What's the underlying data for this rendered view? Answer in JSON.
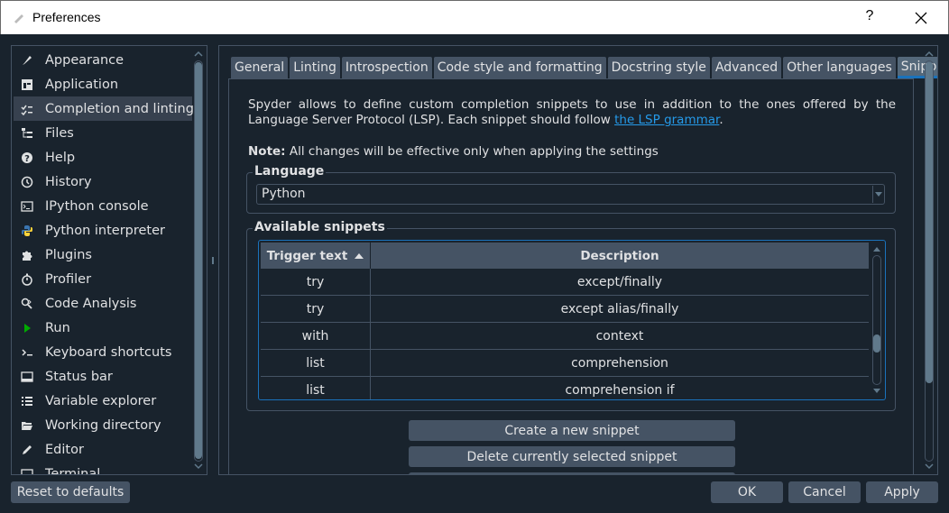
{
  "window": {
    "title": "Preferences",
    "help_label": "?"
  },
  "sidebar": {
    "items": [
      {
        "label": "Appearance",
        "icon": "paintbrush-icon"
      },
      {
        "label": "Application",
        "icon": "window-grid-icon"
      },
      {
        "label": "Completion and linting",
        "icon": "check-list-icon",
        "selected": true
      },
      {
        "label": "Files",
        "icon": "file-tree-icon"
      },
      {
        "label": "Help",
        "icon": "question-circle-icon"
      },
      {
        "label": "History",
        "icon": "history-icon"
      },
      {
        "label": "IPython console",
        "icon": "terminal-icon"
      },
      {
        "label": "Python interpreter",
        "icon": "python-logo-icon"
      },
      {
        "label": "Plugins",
        "icon": "puzzle-icon"
      },
      {
        "label": "Profiler",
        "icon": "stopwatch-icon"
      },
      {
        "label": "Code Analysis",
        "icon": "search-code-icon"
      },
      {
        "label": "Run",
        "icon": "play-icon"
      },
      {
        "label": "Keyboard shortcuts",
        "icon": "keyboard-icon"
      },
      {
        "label": "Status bar",
        "icon": "status-bar-icon"
      },
      {
        "label": "Variable explorer",
        "icon": "variable-list-icon"
      },
      {
        "label": "Working directory",
        "icon": "folder-open-icon"
      },
      {
        "label": "Editor",
        "icon": "pencil-icon"
      },
      {
        "label": "Terminal",
        "icon": "terminal-icon"
      }
    ]
  },
  "tabs": [
    {
      "label": "General"
    },
    {
      "label": "Linting"
    },
    {
      "label": "Introspection"
    },
    {
      "label": "Code style and formatting"
    },
    {
      "label": "Docstring style"
    },
    {
      "label": "Advanced"
    },
    {
      "label": "Other languages"
    },
    {
      "label": "Snippets",
      "active": true
    }
  ],
  "snippets_page": {
    "intro_text": "Spyder allows to define custom completion snippets to use in addition to the ones offered by the Language Server Protocol (LSP). Each snippet should follow ",
    "intro_link": "the LSP grammar",
    "intro_end": ".",
    "note_label": "Note:",
    "note_text": " All changes will be effective only when applying the settings",
    "language_group_title": "Language",
    "language_value": "Python",
    "snippets_group_title": "Available snippets",
    "table": {
      "columns": [
        "Trigger text",
        "Description"
      ],
      "rows": [
        {
          "trigger": "try",
          "description": "except/finally"
        },
        {
          "trigger": "try",
          "description": "except alias/finally"
        },
        {
          "trigger": "with",
          "description": "context"
        },
        {
          "trigger": "list",
          "description": "comprehension"
        },
        {
          "trigger": "list",
          "description": "comprehension if"
        }
      ]
    },
    "create_button": "Create a new snippet",
    "delete_button": "Delete currently selected snippet"
  },
  "footer": {
    "reset_label": "Reset to defaults",
    "ok_label": "OK",
    "cancel_label": "Cancel",
    "apply_label": "Apply"
  },
  "colors": {
    "background": "#19232d",
    "panel_border": "#455364",
    "accent": "#1a72bb",
    "link": "#259ae9"
  }
}
